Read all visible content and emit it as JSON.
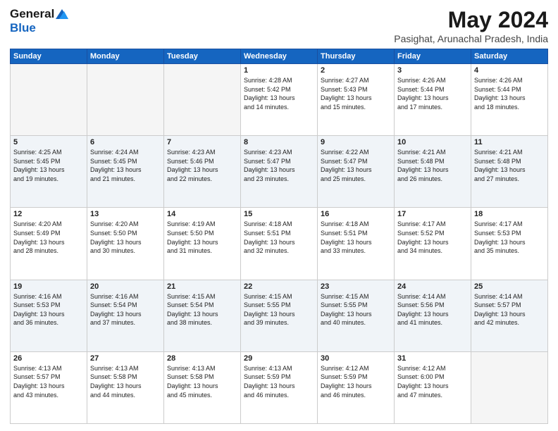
{
  "logo": {
    "general": "General",
    "blue": "Blue"
  },
  "title": "May 2024",
  "location": "Pasighat, Arunachal Pradesh, India",
  "days_header": [
    "Sunday",
    "Monday",
    "Tuesday",
    "Wednesday",
    "Thursday",
    "Friday",
    "Saturday"
  ],
  "weeks": [
    [
      {
        "day": "",
        "info": ""
      },
      {
        "day": "",
        "info": ""
      },
      {
        "day": "",
        "info": ""
      },
      {
        "day": "1",
        "info": "Sunrise: 4:28 AM\nSunset: 5:42 PM\nDaylight: 13 hours\nand 14 minutes."
      },
      {
        "day": "2",
        "info": "Sunrise: 4:27 AM\nSunset: 5:43 PM\nDaylight: 13 hours\nand 15 minutes."
      },
      {
        "day": "3",
        "info": "Sunrise: 4:26 AM\nSunset: 5:44 PM\nDaylight: 13 hours\nand 17 minutes."
      },
      {
        "day": "4",
        "info": "Sunrise: 4:26 AM\nSunset: 5:44 PM\nDaylight: 13 hours\nand 18 minutes."
      }
    ],
    [
      {
        "day": "5",
        "info": "Sunrise: 4:25 AM\nSunset: 5:45 PM\nDaylight: 13 hours\nand 19 minutes."
      },
      {
        "day": "6",
        "info": "Sunrise: 4:24 AM\nSunset: 5:45 PM\nDaylight: 13 hours\nand 21 minutes."
      },
      {
        "day": "7",
        "info": "Sunrise: 4:23 AM\nSunset: 5:46 PM\nDaylight: 13 hours\nand 22 minutes."
      },
      {
        "day": "8",
        "info": "Sunrise: 4:23 AM\nSunset: 5:47 PM\nDaylight: 13 hours\nand 23 minutes."
      },
      {
        "day": "9",
        "info": "Sunrise: 4:22 AM\nSunset: 5:47 PM\nDaylight: 13 hours\nand 25 minutes."
      },
      {
        "day": "10",
        "info": "Sunrise: 4:21 AM\nSunset: 5:48 PM\nDaylight: 13 hours\nand 26 minutes."
      },
      {
        "day": "11",
        "info": "Sunrise: 4:21 AM\nSunset: 5:48 PM\nDaylight: 13 hours\nand 27 minutes."
      }
    ],
    [
      {
        "day": "12",
        "info": "Sunrise: 4:20 AM\nSunset: 5:49 PM\nDaylight: 13 hours\nand 28 minutes."
      },
      {
        "day": "13",
        "info": "Sunrise: 4:20 AM\nSunset: 5:50 PM\nDaylight: 13 hours\nand 30 minutes."
      },
      {
        "day": "14",
        "info": "Sunrise: 4:19 AM\nSunset: 5:50 PM\nDaylight: 13 hours\nand 31 minutes."
      },
      {
        "day": "15",
        "info": "Sunrise: 4:18 AM\nSunset: 5:51 PM\nDaylight: 13 hours\nand 32 minutes."
      },
      {
        "day": "16",
        "info": "Sunrise: 4:18 AM\nSunset: 5:51 PM\nDaylight: 13 hours\nand 33 minutes."
      },
      {
        "day": "17",
        "info": "Sunrise: 4:17 AM\nSunset: 5:52 PM\nDaylight: 13 hours\nand 34 minutes."
      },
      {
        "day": "18",
        "info": "Sunrise: 4:17 AM\nSunset: 5:53 PM\nDaylight: 13 hours\nand 35 minutes."
      }
    ],
    [
      {
        "day": "19",
        "info": "Sunrise: 4:16 AM\nSunset: 5:53 PM\nDaylight: 13 hours\nand 36 minutes."
      },
      {
        "day": "20",
        "info": "Sunrise: 4:16 AM\nSunset: 5:54 PM\nDaylight: 13 hours\nand 37 minutes."
      },
      {
        "day": "21",
        "info": "Sunrise: 4:15 AM\nSunset: 5:54 PM\nDaylight: 13 hours\nand 38 minutes."
      },
      {
        "day": "22",
        "info": "Sunrise: 4:15 AM\nSunset: 5:55 PM\nDaylight: 13 hours\nand 39 minutes."
      },
      {
        "day": "23",
        "info": "Sunrise: 4:15 AM\nSunset: 5:55 PM\nDaylight: 13 hours\nand 40 minutes."
      },
      {
        "day": "24",
        "info": "Sunrise: 4:14 AM\nSunset: 5:56 PM\nDaylight: 13 hours\nand 41 minutes."
      },
      {
        "day": "25",
        "info": "Sunrise: 4:14 AM\nSunset: 5:57 PM\nDaylight: 13 hours\nand 42 minutes."
      }
    ],
    [
      {
        "day": "26",
        "info": "Sunrise: 4:13 AM\nSunset: 5:57 PM\nDaylight: 13 hours\nand 43 minutes."
      },
      {
        "day": "27",
        "info": "Sunrise: 4:13 AM\nSunset: 5:58 PM\nDaylight: 13 hours\nand 44 minutes."
      },
      {
        "day": "28",
        "info": "Sunrise: 4:13 AM\nSunset: 5:58 PM\nDaylight: 13 hours\nand 45 minutes."
      },
      {
        "day": "29",
        "info": "Sunrise: 4:13 AM\nSunset: 5:59 PM\nDaylight: 13 hours\nand 46 minutes."
      },
      {
        "day": "30",
        "info": "Sunrise: 4:12 AM\nSunset: 5:59 PM\nDaylight: 13 hours\nand 46 minutes."
      },
      {
        "day": "31",
        "info": "Sunrise: 4:12 AM\nSunset: 6:00 PM\nDaylight: 13 hours\nand 47 minutes."
      },
      {
        "day": "",
        "info": ""
      }
    ]
  ]
}
